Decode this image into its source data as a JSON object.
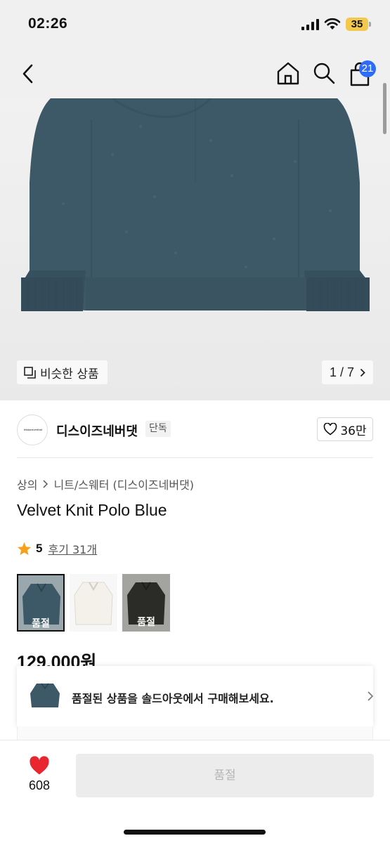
{
  "status_bar": {
    "time": "02:26",
    "battery": "35",
    "icons": [
      "signal-icon",
      "wifi-icon",
      "battery-icon"
    ]
  },
  "nav": {
    "icons": [
      "back-icon",
      "home-icon",
      "search-icon",
      "cart-icon"
    ],
    "cart_badge": "21"
  },
  "gallery": {
    "similar_label": "비슷한 상품",
    "counter": "1 / 7",
    "sweater_color": "#3d5866"
  },
  "brand": {
    "logo_text": "thisisneverthat",
    "name": "디스이즈네버댓",
    "tag": "단독",
    "likes": "36만"
  },
  "breadcrumb": {
    "items": [
      "상의",
      "니트/스웨터 (디스이즈네버댓)"
    ]
  },
  "product": {
    "title": "Velvet Knit Polo Blue",
    "rating": "5",
    "reviews_label": "후기 31개",
    "price": "129,000원"
  },
  "variants": [
    {
      "color": "#3d5866",
      "soldout_label": "품절",
      "selected": true
    },
    {
      "color": "#f3f1e9",
      "soldout_label": "",
      "selected": false
    },
    {
      "color": "#2b2b27",
      "soldout_label": "품절",
      "selected": false
    }
  ],
  "soldout_banner": {
    "text": "품절된 상품을 솔드아웃에서 구매해보세요."
  },
  "bottom_bar": {
    "wish_count": "608",
    "buy_label": "품절"
  },
  "colors": {
    "accent_blue": "#2f6cf6",
    "heart_red": "#e8262f",
    "star_orange": "#f4a21b"
  }
}
